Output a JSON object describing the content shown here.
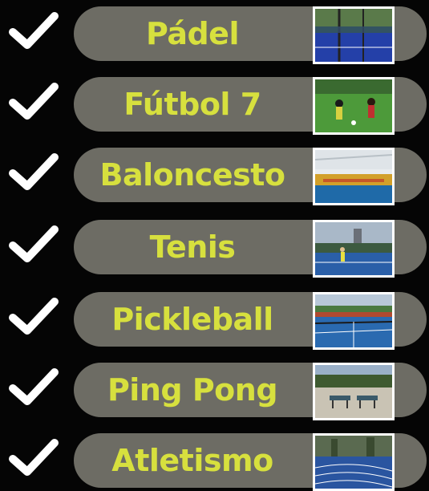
{
  "sports": [
    {
      "name": "Pádel",
      "checked": true,
      "photo": "padel-court-photo"
    },
    {
      "name": "Fútbol 7",
      "checked": true,
      "photo": "football-match-photo"
    },
    {
      "name": "Baloncesto",
      "checked": true,
      "photo": "indoor-court-photo"
    },
    {
      "name": "Tenis",
      "checked": true,
      "photo": "tennis-court-photo"
    },
    {
      "name": "Pickleball",
      "checked": true,
      "photo": "pickleball-court-photo"
    },
    {
      "name": "Ping Pong",
      "checked": true,
      "photo": "ping-pong-tables-photo"
    },
    {
      "name": "Atletismo",
      "checked": true,
      "photo": "running-track-photo"
    }
  ],
  "colors": {
    "background": "#050505",
    "pill": "#6d6c64",
    "label_text": "#d7e03e",
    "check": "#ffffff",
    "thumb_border": "#ffffff"
  }
}
